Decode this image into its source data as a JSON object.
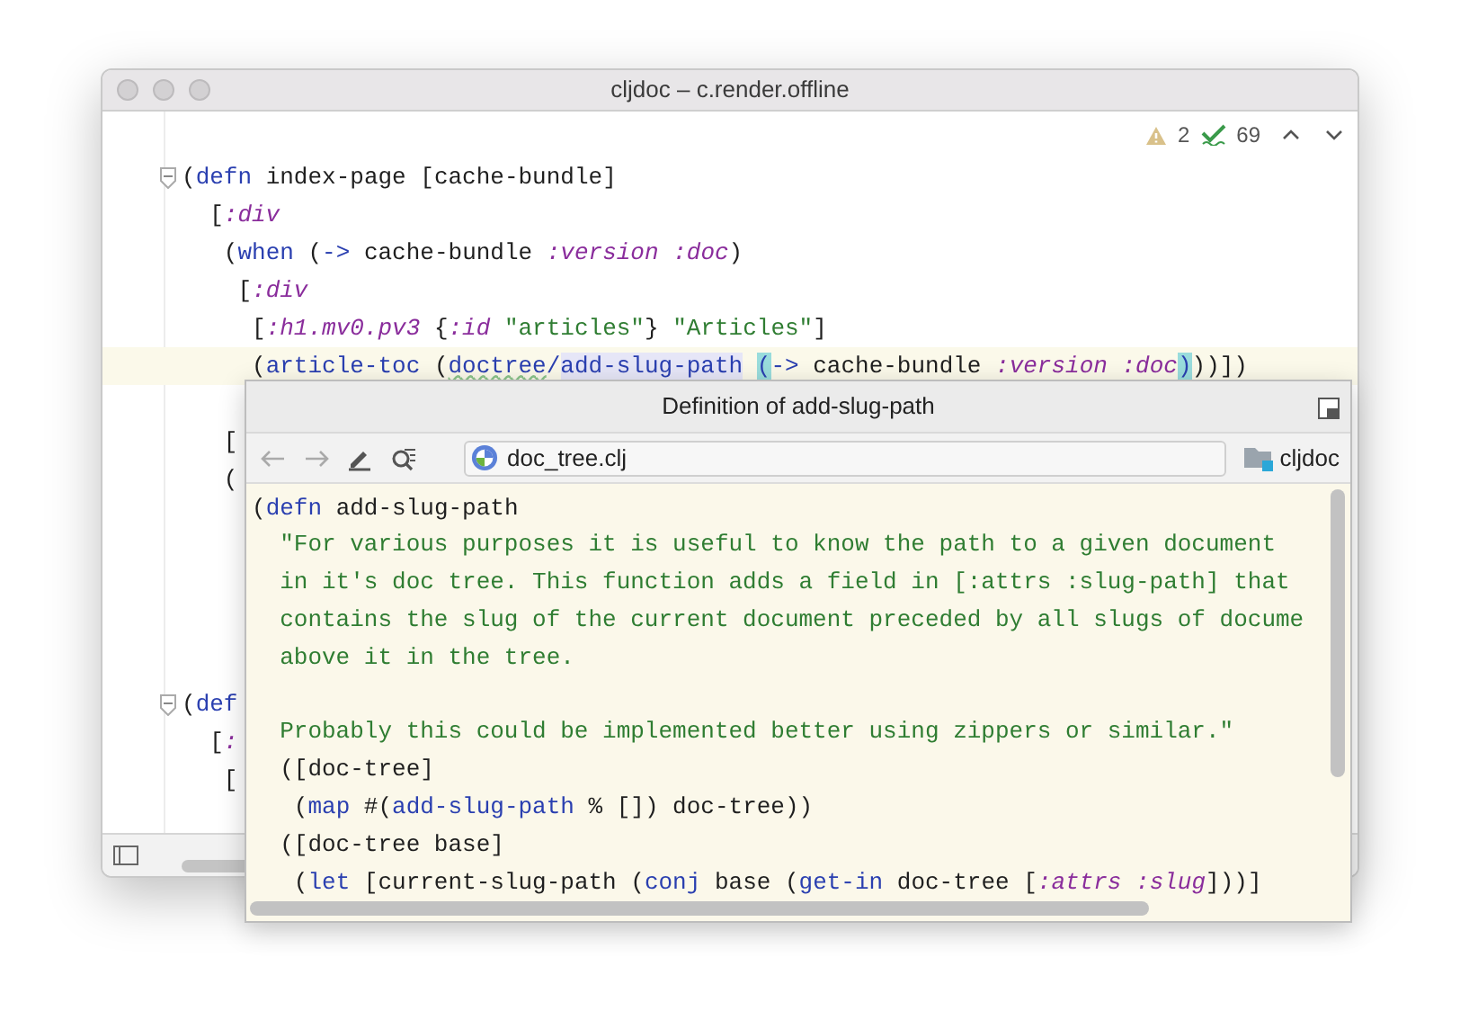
{
  "window": {
    "title": "cljdoc – c.render.offline"
  },
  "inspections": {
    "warnings": "2",
    "passed": "69"
  },
  "editor": {
    "upper_lines": [
      {
        "fold": true,
        "current": false,
        "tokens": [
          {
            "text": "(",
            "kind": "plain"
          },
          {
            "text": "defn",
            "kind": "keyword"
          },
          {
            "text": " index-page [cache-bundle]",
            "kind": "plain"
          }
        ]
      },
      {
        "fold": false,
        "current": false,
        "tokens": [
          {
            "text": "  [",
            "kind": "plain"
          },
          {
            "text": ":div",
            "kind": "kw-arg"
          }
        ]
      },
      {
        "fold": false,
        "current": false,
        "tokens": [
          {
            "text": "   (",
            "kind": "plain"
          },
          {
            "text": "when",
            "kind": "keyword"
          },
          {
            "text": " (",
            "kind": "plain"
          },
          {
            "text": "->",
            "kind": "keyword"
          },
          {
            "text": " cache-bundle ",
            "kind": "plain"
          },
          {
            "text": ":version :doc",
            "kind": "kw-arg"
          },
          {
            "text": ")",
            "kind": "plain"
          }
        ]
      },
      {
        "fold": false,
        "current": false,
        "tokens": [
          {
            "text": "    [",
            "kind": "plain"
          },
          {
            "text": ":div",
            "kind": "kw-arg"
          }
        ]
      },
      {
        "fold": false,
        "current": false,
        "tokens": [
          {
            "text": "     [",
            "kind": "plain"
          },
          {
            "text": ":h1.mv0.pv3",
            "kind": "kw-arg"
          },
          {
            "text": " {",
            "kind": "plain"
          },
          {
            "text": ":id",
            "kind": "kw-arg"
          },
          {
            "text": " \"articles\"",
            "kind": "string"
          },
          {
            "text": "} ",
            "kind": "plain"
          },
          {
            "text": "\"Articles\"",
            "kind": "string"
          },
          {
            "text": "]",
            "kind": "plain"
          }
        ]
      },
      {
        "fold": false,
        "current": true,
        "tokens": [
          {
            "text": "     (",
            "kind": "plain"
          },
          {
            "text": "article-toc",
            "kind": "fn"
          },
          {
            "text": " (",
            "kind": "plain"
          },
          {
            "text": "doctree",
            "kind": "ns"
          },
          {
            "text": "/",
            "kind": "fn"
          },
          {
            "text": "add-slug-path",
            "kind": "usage"
          },
          {
            "text": "(",
            "kind": "spaced-brace"
          },
          {
            "text": "->",
            "kind": "keyword"
          },
          {
            "text": " cache-bundle ",
            "kind": "plain"
          },
          {
            "text": ":version :doc",
            "kind": "kw-arg"
          },
          {
            "text": ")",
            "kind": "brace"
          },
          {
            "text": "))])",
            "kind": "plain"
          }
        ]
      }
    ],
    "mid_lines": [
      {
        "fold": false,
        "current": false,
        "tokens": [
          {
            "text": "   [",
            "kind": "plain"
          }
        ]
      },
      {
        "fold": false,
        "current": false,
        "tokens": [
          {
            "text": "   (",
            "kind": "plain"
          }
        ]
      }
    ],
    "lower_lines": [
      {
        "fold": true,
        "current": false,
        "tokens": [
          {
            "text": "(",
            "kind": "plain"
          },
          {
            "text": "def",
            "kind": "keyword"
          }
        ]
      },
      {
        "fold": false,
        "current": false,
        "tokens": [
          {
            "text": "  [",
            "kind": "plain"
          },
          {
            "text": ":",
            "kind": "kw-arg"
          }
        ]
      },
      {
        "fold": false,
        "current": false,
        "tokens": [
          {
            "text": "   [",
            "kind": "plain"
          }
        ]
      }
    ]
  },
  "popup": {
    "title": "Definition of add-slug-path",
    "file": "doc_tree.clj",
    "module": "cljdoc",
    "lines": [
      {
        "kind": "code",
        "tokens": [
          {
            "text": "(",
            "kind": "plain"
          },
          {
            "text": "defn",
            "kind": "keyword"
          },
          {
            "text": " add-slug-path",
            "kind": "plain"
          }
        ]
      },
      {
        "kind": "code",
        "tokens": [
          {
            "text": "  \"For various purposes it is useful to know the path to a given document",
            "kind": "string"
          }
        ]
      },
      {
        "kind": "code",
        "tokens": [
          {
            "text": "  in it's doc tree. This function adds a field in [:attrs :slug-path] that",
            "kind": "string"
          }
        ]
      },
      {
        "kind": "code",
        "tokens": [
          {
            "text": "  contains the slug of the current document preceded by all slugs of docume",
            "kind": "string"
          }
        ]
      },
      {
        "kind": "code",
        "tokens": [
          {
            "text": "  above it in the tree.",
            "kind": "string"
          }
        ]
      },
      {
        "kind": "blank"
      },
      {
        "kind": "code",
        "tokens": [
          {
            "text": "  Probably this could be implemented better using zippers or similar.\"",
            "kind": "string"
          }
        ]
      },
      {
        "kind": "code",
        "tokens": [
          {
            "text": "  ([doc-tree]",
            "kind": "plain"
          }
        ]
      },
      {
        "kind": "code",
        "tokens": [
          {
            "text": "   (",
            "kind": "plain"
          },
          {
            "text": "map",
            "kind": "keyword"
          },
          {
            "text": " #(",
            "kind": "plain"
          },
          {
            "text": "add-slug-path",
            "kind": "fn"
          },
          {
            "text": " % []) doc-tree))",
            "kind": "plain"
          }
        ]
      },
      {
        "kind": "code",
        "tokens": [
          {
            "text": "  ([doc-tree base]",
            "kind": "plain"
          }
        ]
      },
      {
        "kind": "code",
        "tokens": [
          {
            "text": "   (",
            "kind": "plain"
          },
          {
            "text": "let",
            "kind": "keyword"
          },
          {
            "text": " [current-slug-path (",
            "kind": "plain"
          },
          {
            "text": "conj",
            "kind": "keyword"
          },
          {
            "text": " base (",
            "kind": "plain"
          },
          {
            "text": "get-in",
            "kind": "keyword"
          },
          {
            "text": " doc-tree [",
            "kind": "plain"
          },
          {
            "text": ":attrs :slug",
            "kind": "kw-arg"
          },
          {
            "text": "]))]",
            "kind": "plain"
          }
        ]
      }
    ]
  }
}
